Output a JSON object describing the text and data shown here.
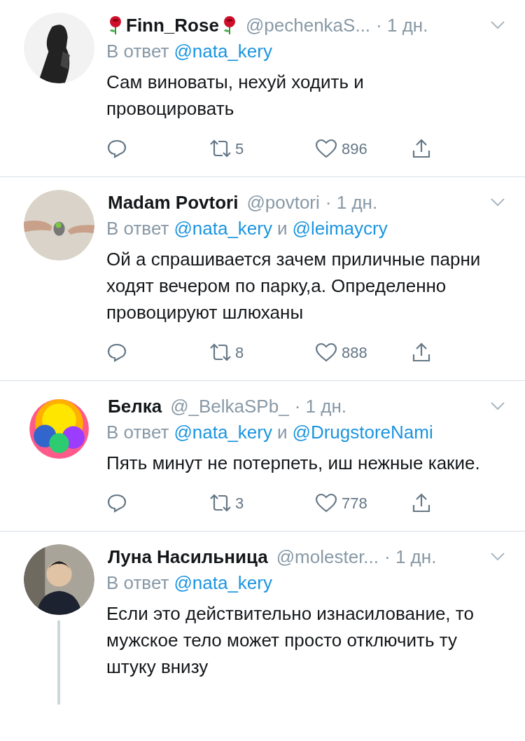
{
  "tweets": [
    {
      "name": "Finn_Rose",
      "rose_badges": true,
      "handle": "@pechenkaS...",
      "time": "· 1 дн.",
      "reply_to": [
        {
          "kind": "plain",
          "text": "В ответ"
        },
        {
          "kind": "mention",
          "text": "@nata_kery"
        }
      ],
      "text": "Сам виноваты, нехуй ходить и провоцировать",
      "retweets": "5",
      "likes": "896",
      "thread_continues": false
    },
    {
      "name": "Madam Povtori",
      "rose_badges": false,
      "handle": "@povtori",
      "time": "· 1 дн.",
      "reply_to": [
        {
          "kind": "plain",
          "text": "В ответ"
        },
        {
          "kind": "mention",
          "text": "@nata_kery"
        },
        {
          "kind": "plain",
          "text": "и"
        },
        {
          "kind": "mention",
          "text": "@leimaycry"
        }
      ],
      "text": "Ой а спрашивается зачем приличные парни ходят вечером по парку,а. Определенно провоцируют шлюханы",
      "retweets": "8",
      "likes": "888",
      "thread_continues": false
    },
    {
      "name": "Белка",
      "rose_badges": false,
      "handle": "@_BelkaSPb_",
      "time": "· 1 дн.",
      "reply_to": [
        {
          "kind": "plain",
          "text": "В ответ"
        },
        {
          "kind": "mention",
          "text": "@nata_kery"
        },
        {
          "kind": "plain",
          "text": "и"
        },
        {
          "kind": "mention",
          "text": "@DrugstoreNami"
        }
      ],
      "text": "Пять минут не потерпеть, иш нежные какие.",
      "retweets": "3",
      "likes": "778",
      "thread_continues": false
    },
    {
      "name": "Луна Насильница",
      "rose_badges": false,
      "handle": "@molester...",
      "time": "· 1 дн.",
      "reply_to": [
        {
          "kind": "plain",
          "text": "В ответ"
        },
        {
          "kind": "mention",
          "text": "@nata_kery"
        }
      ],
      "text": "Если это действительно изнасилование, то мужское тело может просто отключить ту штуку внизу",
      "thread_continues": true
    }
  ]
}
